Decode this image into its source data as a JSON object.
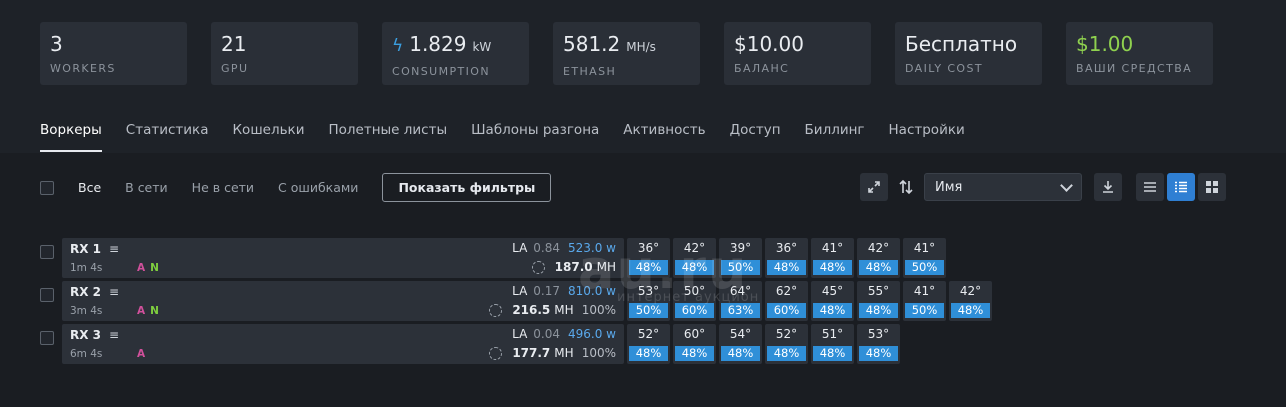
{
  "stats": [
    {
      "value": "3",
      "unit": "",
      "label": "WORKERS"
    },
    {
      "value": "21",
      "unit": "",
      "label": "GPU"
    },
    {
      "value": "1.829",
      "unit": "kW",
      "label": "CONSUMPTION",
      "icon": "lightning-icon"
    },
    {
      "value": "581.2",
      "unit": "MH/s",
      "label": "ETHASH"
    },
    {
      "value": "$10.00",
      "unit": "",
      "label": "БАЛАНС"
    },
    {
      "value": "Бесплатно",
      "unit": "",
      "label": "DAILY COST"
    },
    {
      "value": "$1.00",
      "unit": "",
      "label": "ВАШИ СРЕДСТВА"
    }
  ],
  "tabs": [
    "Воркеры",
    "Статистика",
    "Кошельки",
    "Полетные листы",
    "Шаблоны разгона",
    "Активность",
    "Доступ",
    "Биллинг",
    "Настройки"
  ],
  "active_tab": "Воркеры",
  "filters": {
    "items": [
      "Все",
      "В сети",
      "Не в сети",
      "С ошибками"
    ],
    "active": "Все",
    "show_filters_label": "Показать фильтры"
  },
  "sort": {
    "selected": "Имя"
  },
  "workers": [
    {
      "name": "RX 1",
      "uptime": "1m 4s",
      "flags": [
        "A",
        "N"
      ],
      "la_label": "LA",
      "la": "0.84",
      "power": "523.0 w",
      "hash_value": "187.0",
      "hash_unit": "MH",
      "hash_pct": "",
      "gpus": [
        {
          "temp": "36°",
          "fan": "48%"
        },
        {
          "temp": "42°",
          "fan": "48%"
        },
        {
          "temp": "39°",
          "fan": "50%"
        },
        {
          "temp": "36°",
          "fan": "48%"
        },
        {
          "temp": "41°",
          "fan": "48%"
        },
        {
          "temp": "42°",
          "fan": "48%"
        },
        {
          "temp": "41°",
          "fan": "50%"
        }
      ]
    },
    {
      "name": "RX 2",
      "uptime": "3m 4s",
      "flags": [
        "A",
        "N"
      ],
      "la_label": "LA",
      "la": "0.17",
      "power": "810.0 w",
      "hash_value": "216.5",
      "hash_unit": "MH",
      "hash_pct": "100%",
      "gpus": [
        {
          "temp": "53°",
          "fan": "50%"
        },
        {
          "temp": "50°",
          "fan": "60%"
        },
        {
          "temp": "64°",
          "fan": "63%"
        },
        {
          "temp": "62°",
          "fan": "60%"
        },
        {
          "temp": "45°",
          "fan": "48%"
        },
        {
          "temp": "55°",
          "fan": "48%"
        },
        {
          "temp": "41°",
          "fan": "50%"
        },
        {
          "temp": "42°",
          "fan": "48%"
        }
      ]
    },
    {
      "name": "RX 3",
      "uptime": "6m 4s",
      "flags": [
        "A"
      ],
      "la_label": "LA",
      "la": "0.04",
      "power": "496.0 w",
      "hash_value": "177.7",
      "hash_unit": "MH",
      "hash_pct": "100%",
      "gpus": [
        {
          "temp": "52°",
          "fan": "48%"
        },
        {
          "temp": "60°",
          "fan": "48%"
        },
        {
          "temp": "54°",
          "fan": "48%"
        },
        {
          "temp": "52°",
          "fan": "48%"
        },
        {
          "temp": "51°",
          "fan": "48%"
        },
        {
          "temp": "53°",
          "fan": "48%"
        }
      ]
    }
  ],
  "watermark": {
    "main": "au.ru",
    "sub": "интернет аукцион"
  }
}
